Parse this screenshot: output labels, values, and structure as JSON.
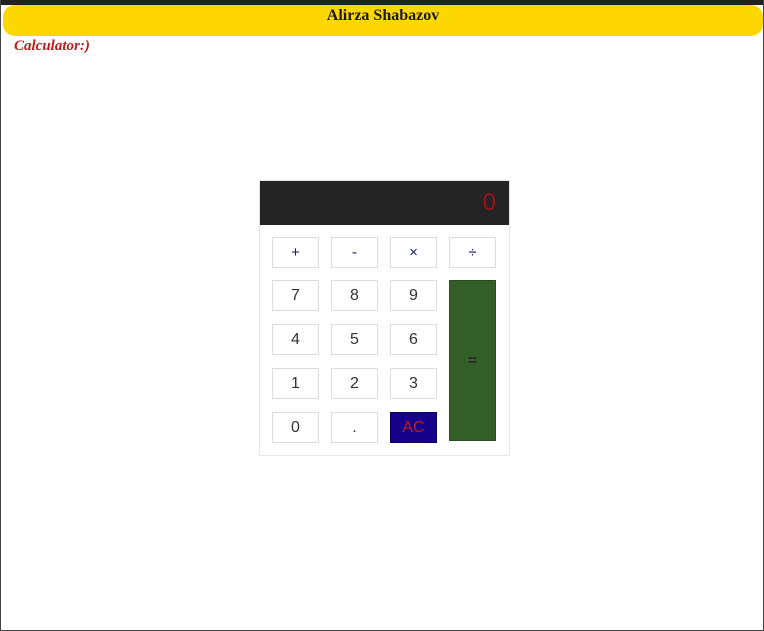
{
  "header": {
    "title": "Alirza Shabazov"
  },
  "subtitle": "Calculator:)",
  "calculator": {
    "display_value": "0",
    "operators": {
      "plus": "+",
      "minus": "-",
      "multiply": "×",
      "divide": "÷"
    },
    "digits": {
      "d7": "7",
      "d8": "8",
      "d9": "9",
      "d4": "4",
      "d5": "5",
      "d6": "6",
      "d1": "1",
      "d2": "2",
      "d3": "3",
      "d0": "0"
    },
    "decimal": ".",
    "clear": "AC",
    "equals": "="
  },
  "colors": {
    "header_background": "#FFD700",
    "subtitle_text": "#c21818",
    "display_background": "#242424",
    "display_text": "#a01010",
    "clear_background": "#16008a",
    "clear_text": "#c41a1a",
    "equals_background": "#345e28"
  }
}
